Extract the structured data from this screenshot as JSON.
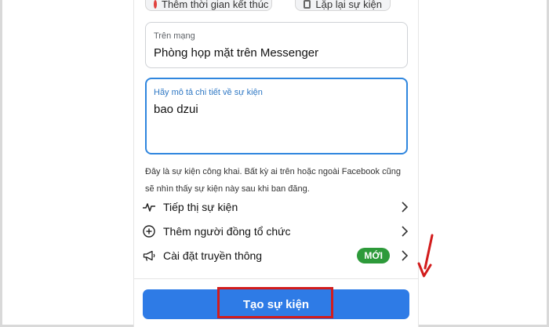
{
  "top_chips": {
    "left_label": "Thêm thời gian kết thúc",
    "right_label": "Lặp lại sự kiện"
  },
  "online_field": {
    "label": "Trên mạng",
    "value": "Phòng họp mặt trên Messenger"
  },
  "description_field": {
    "label": "Hãy mô tả chi tiết về sự kiện",
    "value": "bao dzui"
  },
  "notice": "Đây là sự kiện công khai. Bất kỳ ai trên hoặc ngoài Facebook cũng sẽ nhìn thấy sự kiện này sau khi ban đăng.",
  "menu": {
    "items": [
      {
        "label": "Tiếp thị sự kiện",
        "icon": "activity-icon"
      },
      {
        "label": "Thêm người đồng tổ chức",
        "icon": "plus-circle-icon"
      },
      {
        "label": "Cài đặt truyền thông",
        "icon": "megaphone-icon",
        "badge": "MỚI"
      }
    ]
  },
  "create_button": {
    "label": "Tạo sự kiện"
  },
  "colors": {
    "primary": "#2e7be6",
    "focus_border": "#2f86de",
    "badge_green": "#2d9a3a",
    "annotation_red": "#d21c1c"
  }
}
